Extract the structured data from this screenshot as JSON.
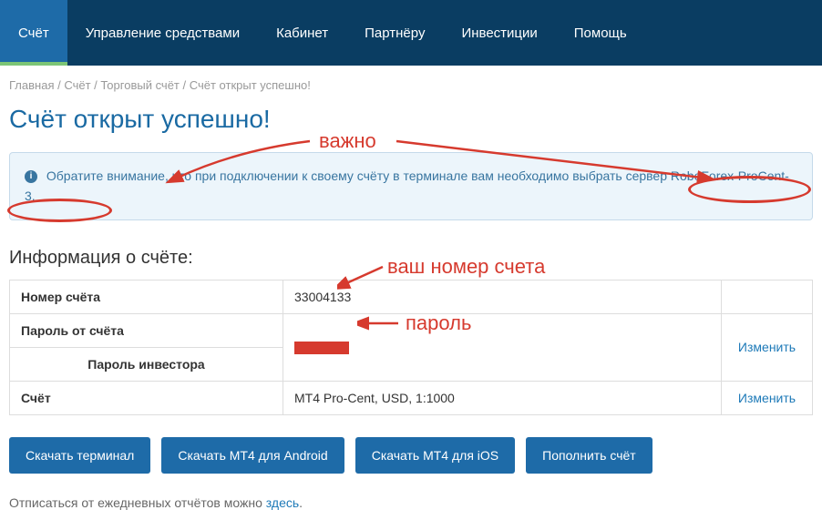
{
  "nav": {
    "items": [
      {
        "label": "Счёт",
        "active": true
      },
      {
        "label": "Управление средствами"
      },
      {
        "label": "Кабинет"
      },
      {
        "label": "Партнёру"
      },
      {
        "label": "Инвестиции"
      },
      {
        "label": "Помощь"
      }
    ]
  },
  "breadcrumb": {
    "items": [
      "Главная",
      "Счёт",
      "Торговый счёт",
      "Счёт открыт успешно!"
    ]
  },
  "page": {
    "title": "Счёт открыт успешно!"
  },
  "info_box": {
    "text": "Обратите внимание, что при подключении к своему счёту в терминале вам необходимо выбрать сервер RoboForex-ProCent-3."
  },
  "account_info": {
    "title": "Информация о счёте:",
    "rows": [
      {
        "label": "Номер счёта",
        "value": "33004133",
        "action": ""
      },
      {
        "label": "Пароль от счёта",
        "value": "",
        "action": "Изменить",
        "redacted": true
      },
      {
        "label": "Пароль инвестора",
        "value": "",
        "action": ""
      },
      {
        "label": "Счёт",
        "value": "MT4 Pro-Cent, USD, 1:1000",
        "action": "Изменить"
      }
    ]
  },
  "buttons": {
    "download_terminal": "Скачать терминал",
    "download_mt4_android": "Скачать MT4 для Android",
    "download_mt4_ios": "Скачать MT4 для iOS",
    "deposit": "Пополнить счёт"
  },
  "footer": {
    "text_prefix": "Отписаться от ежедневных отчётов можно ",
    "link": "здесь",
    "text_suffix": "."
  },
  "annotations": {
    "important": "важно",
    "account_number": "ваш номер счета",
    "password": "пароль"
  }
}
